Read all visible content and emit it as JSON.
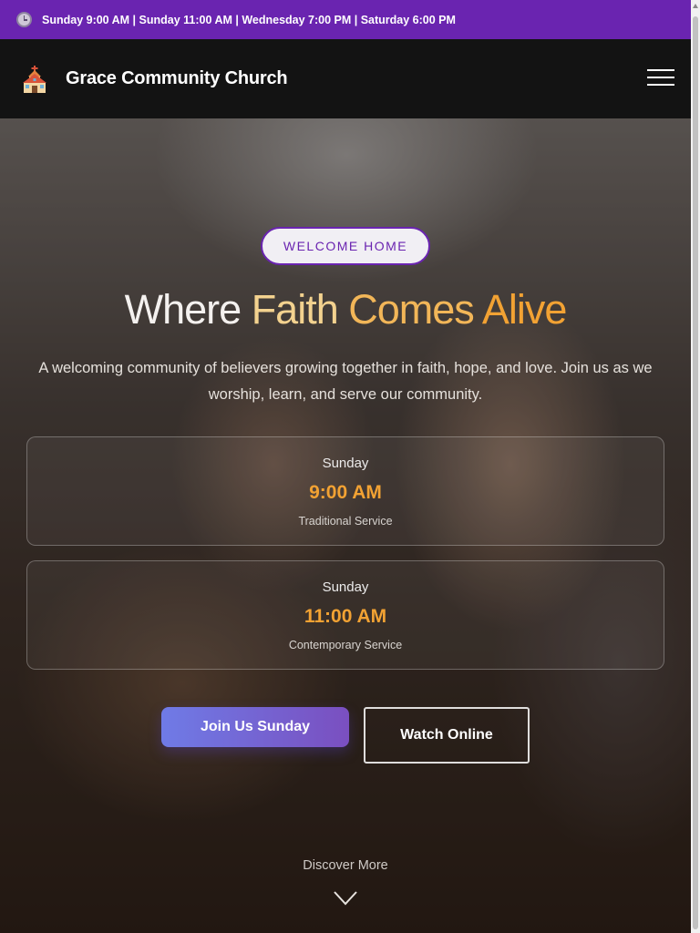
{
  "topbar": {
    "schedule": "Sunday 9:00 AM | Sunday 11:00 AM | Wednesday 7:00 PM | Saturday 6:00 PM",
    "icon": "clock-icon"
  },
  "header": {
    "brand": "Grace Community Church",
    "logo_icon": "church-icon",
    "menu_icon": "hamburger-menu-icon"
  },
  "hero": {
    "badge": "WELCOME HOME",
    "headline": {
      "word1": "Where",
      "word2": "Faith",
      "word3": "Comes",
      "word4": "Alive"
    },
    "subtext": "A welcoming community of believers growing together in faith, hope, and love. Join us as we worship, learn, and serve our community.",
    "services": [
      {
        "day": "Sunday",
        "time": "9:00 AM",
        "type": "Traditional Service"
      },
      {
        "day": "Sunday",
        "time": "11:00 AM",
        "type": "Contemporary Service"
      }
    ],
    "primary_button": "Join Us Sunday",
    "secondary_button": "Watch Online",
    "discover": "Discover More",
    "discover_icon": "chevron-down-icon"
  },
  "colors": {
    "topbar": "#6a24b0",
    "header": "#131313",
    "accent_orange": "#f2a233",
    "accent_purple": "#6a24b0"
  }
}
